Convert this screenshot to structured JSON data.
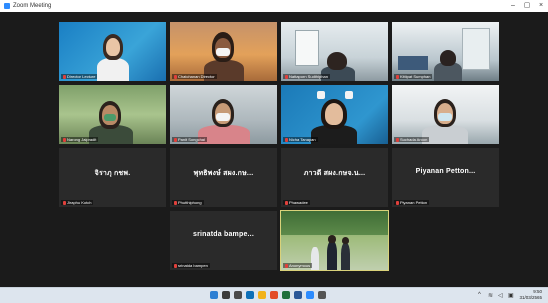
{
  "window": {
    "title": "Zoom Meeting"
  },
  "participants": [
    {
      "name": "Director Lecture",
      "type": "video"
    },
    {
      "name": "Chatchanan Director",
      "type": "video"
    },
    {
      "name": "Nattaporn Sudthiphan",
      "type": "video"
    },
    {
      "name": "Kittipat Sumphan",
      "type": "video"
    },
    {
      "name": "Narong Jaipradit",
      "type": "video"
    },
    {
      "name": "Panit Songchai",
      "type": "video"
    },
    {
      "name": "Nicha Tanapan",
      "type": "video"
    },
    {
      "name": "Suchada Aroon",
      "type": "video"
    },
    {
      "name": "จิราภุ กชพ.",
      "label": "Jiraphu Kotch",
      "type": "name"
    },
    {
      "name": "พุทธิพงษ์ สผง.กษ...",
      "label": "Phutthiphong",
      "type": "name"
    },
    {
      "name": "ภาวดี สผง.กษจ.น...",
      "label": "Phawadee",
      "type": "name"
    },
    {
      "name": "Piyanan Petton...",
      "label": "Piyanan Petton",
      "type": "name"
    },
    {
      "name": "srinatda bampe...",
      "label": "srinatda bampen",
      "type": "name"
    },
    {
      "name": "Anonymous",
      "type": "video"
    }
  ],
  "taskbar": {
    "time": "9:50",
    "date": "31/03/2565"
  },
  "colors": {
    "active_speaker_border": "#d9d27a",
    "muted_mic": "#e0403b"
  }
}
